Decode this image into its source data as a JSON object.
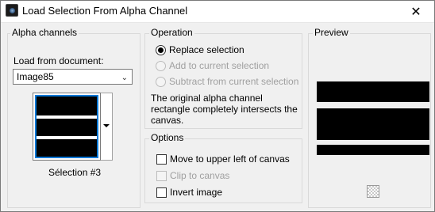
{
  "window": {
    "title": "Load Selection From Alpha Channel",
    "close_glyph": "✕"
  },
  "alpha_channels": {
    "label": "Alpha channels",
    "load_from_label": "Load from document:",
    "document_value": "Image85",
    "selection_label": "Sélection #3"
  },
  "operation": {
    "label": "Operation",
    "options": [
      {
        "label": "Replace selection",
        "checked": true,
        "enabled": true
      },
      {
        "label": "Add to current selection",
        "checked": false,
        "enabled": false
      },
      {
        "label": "Subtract from current selection",
        "checked": false,
        "enabled": false
      }
    ],
    "info_text": "The original alpha channel rectangle completely intersects the canvas."
  },
  "options": {
    "label": "Options",
    "items": [
      {
        "label": "Move to upper left of canvas",
        "checked": false,
        "enabled": true
      },
      {
        "label": "Clip to canvas",
        "checked": false,
        "enabled": false
      },
      {
        "label": "Invert image",
        "checked": false,
        "enabled": true
      }
    ]
  },
  "preview": {
    "label": "Preview"
  }
}
